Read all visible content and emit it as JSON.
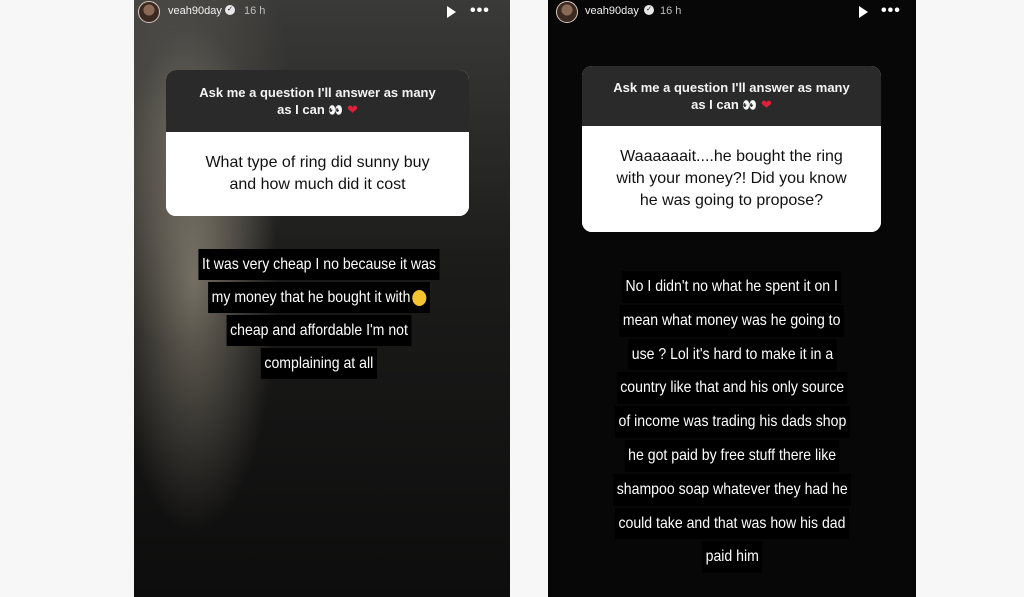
{
  "stories": [
    {
      "username": "veah90day",
      "timestamp": "16 h",
      "prompt_lines": [
        "Ask me a question I'll answer as many",
        "as I can 👀 ❤️"
      ],
      "question_lines": [
        "What type of ring did sunny buy",
        "and how much did it cost"
      ],
      "answer_lines": [
        "It was very cheap I no because it was",
        "my money that he bought it with",
        "cheap and affordable I'm not",
        "complaining at all"
      ]
    },
    {
      "username": "veah90day",
      "timestamp": "16 h",
      "prompt_lines": [
        "Ask me a question I'll answer as many",
        "as I can 👀 ❤️"
      ],
      "question_lines": [
        "Waaaaaait....he bought the ring",
        "with your money?! Did you know",
        "he was going to propose?"
      ],
      "answer_lines": [
        "No I didn't no what he spent it on I",
        "mean what money was he going to",
        "use ? Lol it's hard to make it in a",
        "country like that and his only source",
        "of income was trading his dads shop",
        "he got paid by free stuff there like",
        "shampoo soap  whatever they had he",
        "could take and that was how his dad",
        "paid him"
      ]
    }
  ],
  "icons": {
    "verified": "verified-badge-icon",
    "play": "play-icon",
    "more": "more-options-icon",
    "laugh_emoji": "rolling-laughing-emoji-icon"
  }
}
